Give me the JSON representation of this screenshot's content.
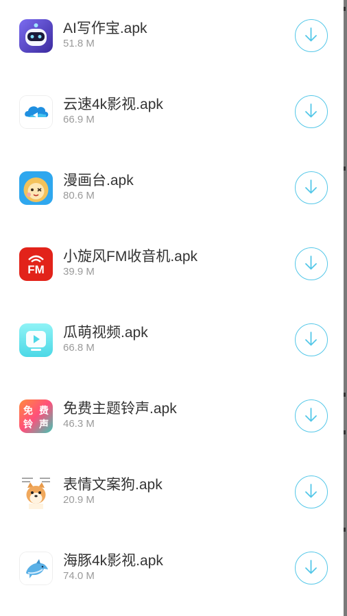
{
  "colors": {
    "accent": "#53c7e8",
    "name_text": "#333333",
    "size_text": "#9a9a9a"
  },
  "apps": [
    {
      "name": "AI写作宝.apk",
      "size": "51.8 M",
      "icon": "robot-app-icon"
    },
    {
      "name": "云速4k影视.apk",
      "size": "66.9 M",
      "icon": "cloud-app-icon"
    },
    {
      "name": "漫画台.apk",
      "size": "80.6 M",
      "icon": "comic-lion-app-icon"
    },
    {
      "name": "小旋风FM收音机.apk",
      "size": "39.9 M",
      "icon": "fm-radio-app-icon"
    },
    {
      "name": "瓜萌视频.apk",
      "size": "66.8 M",
      "icon": "tv-play-app-icon"
    },
    {
      "name": "免费主题铃声.apk",
      "size": "46.3 M",
      "icon": "ringtone-app-icon"
    },
    {
      "name": "表情文案狗.apk",
      "size": "20.9 M",
      "icon": "shiba-dog-app-icon"
    },
    {
      "name": "海豚4k影视.apk",
      "size": "74.0 M",
      "icon": "dolphin-app-icon"
    }
  ],
  "icon_text": {
    "fm": "FM",
    "ringtone": [
      "免",
      "费",
      "铃",
      "声"
    ]
  }
}
